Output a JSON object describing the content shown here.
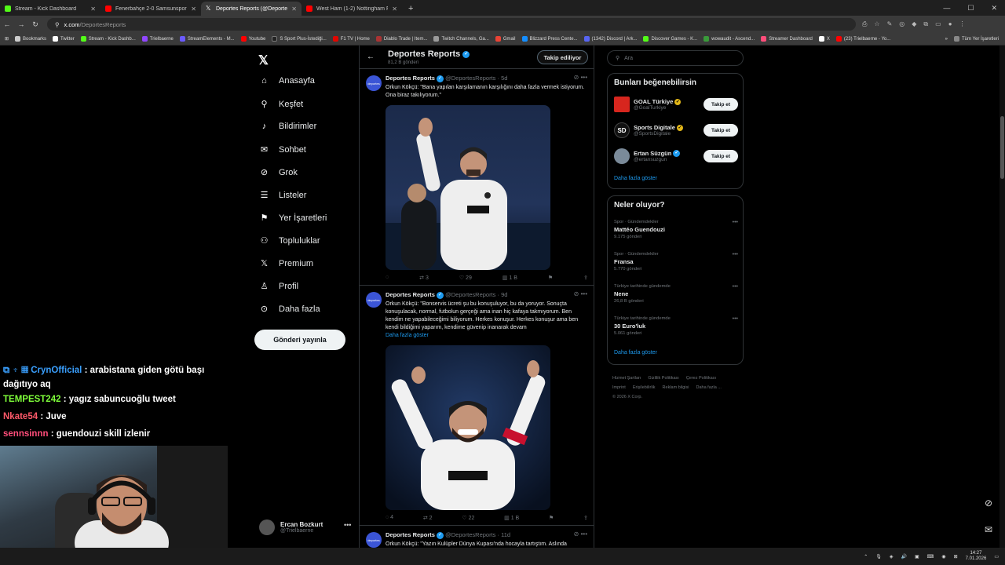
{
  "browser": {
    "tabs": [
      {
        "title": "Stream - Kick Dashboard",
        "color": "#53fc18"
      },
      {
        "title": "Fenerbahçe 2-0 Samsunspor | M",
        "color": "#ff0000"
      },
      {
        "title": "Deportes Reports (@DeportesR",
        "color": "#ffffff"
      },
      {
        "title": "West Ham (1-2) Nottingham Fo",
        "color": "#ff0000"
      }
    ],
    "url_host": "x.com",
    "url_path": "/DeportesReports",
    "bookmarks": [
      "Bookmarks",
      "Twitter",
      "Stream - Kick Dashb...",
      "Trielbaerne",
      "StreamElements - M...",
      "Youtube",
      "S Sport Plus-İstediği...",
      "F1 TV | Home",
      "Diablo Trade | Item...",
      "Twitch Channels, Ga...",
      "Gmail",
      "Blizzard Press Cente...",
      "(1342) Discord | Ark...",
      "Discover Games - K...",
      "wowaudit - Ascend...",
      "Streamer Dashboard",
      "X",
      "(23) Trielbaerne - Yo..."
    ],
    "bookmarks_folder": "Tüm Yer İşaretleri"
  },
  "nav": {
    "items": [
      "Anasayfa",
      "Keşfet",
      "Bildirimler",
      "Sohbet",
      "Grok",
      "Listeler",
      "Yer İşaretleri",
      "Topluluklar",
      "Premium",
      "Profil",
      "Daha fazla"
    ],
    "post_button": "Gönderi yayınla",
    "account_name": "Ercan Bozkurt",
    "account_handle": "@Trielbaerne"
  },
  "profile": {
    "name": "Deportes Reports",
    "posts_count": "81,2 B gönderi",
    "follow_label": "Takip ediliyor"
  },
  "tweets": [
    {
      "author": "Deportes Reports",
      "handle": "@DeportesReports · 5d",
      "text": "Orkun Kökçü: \"Bana yapılan karşılamanın karşılığını daha fazla vermek istiyorum. Ona biraz takılıyorum.\"",
      "replies": "",
      "retweets": "3",
      "likes": "29",
      "views": "1 B"
    },
    {
      "author": "Deportes Reports",
      "handle": "@DeportesReports · 9d",
      "text": "Orkun Kökçü: \"Bonservis ücreti şu bu konuşuluyor, bu da yoruyor. Sonuçta konuşulacak, normal, futbolun gerçeği ama inan hiç kafaya takmıyorum. Ben kendim ne yapabileceğimi biliyorum. Herkes konuşur. Herkes konuşur ama ben kendi bildiğimi yaparım, kendime güvenip inanarak devam",
      "show_more": "Daha fazla göster",
      "replies": "4",
      "retweets": "2",
      "likes": "22",
      "views": "1 B"
    },
    {
      "author": "Deportes Reports",
      "handle": "@DeportesReports · 11d",
      "text": "Orkun Kökçü: \"Yazın Kulüpler Dünya Kupası'nda hocayla tartıştım. Aslında"
    }
  ],
  "right": {
    "search_placeholder": "Ara",
    "who_title": "Bunları beğenebilirsin",
    "suggestions": [
      {
        "name": "GOAL Türkiye",
        "handle": "@GoalTurkiye",
        "button": "Takip et",
        "color": "#d7261e"
      },
      {
        "name": "Sports Digitale",
        "handle": "@SportsDigitale",
        "button": "Takip et",
        "color": "#111111"
      },
      {
        "name": "Ertan Süzgün",
        "handle": "@ertansuzgun",
        "button": "Takip et",
        "color": "#7a8a99"
      }
    ],
    "show_more": "Daha fazla göster",
    "trends_title": "Neler oluyor?",
    "trends": [
      {
        "category": "Spor · Gündemdekiler",
        "title": "Mattéo Guendouzi",
        "posts": "9.175 gönderi"
      },
      {
        "category": "Spor · Gündemdekiler",
        "title": "Fransa",
        "posts": "5.770 gönderi"
      },
      {
        "category": "Türkiye tarihinde gündemde",
        "title": "Nene",
        "posts": "26,8 B gönderi"
      },
      {
        "category": "Türkiye tarihinde gündemde",
        "title": "30 Euro'luk",
        "posts": "5.061 gönderi"
      }
    ],
    "trends_more": "Daha fazla göster",
    "footer": [
      "Hizmet Şartları",
      "Gizlilik Politikası",
      "Çerez Politikası",
      "Imprint",
      "Erişilebilirlik",
      "Reklam bilgisi",
      "Daha fazla ...",
      "© 2026 X Corp."
    ]
  },
  "chat": [
    {
      "user": "CrynOfficial",
      "msg": ": arabistana giden götü başı dağıtıyo aq",
      "color": "#3aa0ff"
    },
    {
      "user": "TEMPEST242",
      "msg": ": yagız sabuncuoğlu tweet",
      "color": "#7fff3a"
    },
    {
      "user": "Nkate54",
      "msg": ": Juve",
      "color": "#ff5a6a"
    },
    {
      "user": "sennsinnn",
      "msg": ": guendouzi skill izlenir",
      "color": "#ff4d7a"
    }
  ],
  "clock": {
    "time": "14:27",
    "date": "7.01.2026"
  }
}
